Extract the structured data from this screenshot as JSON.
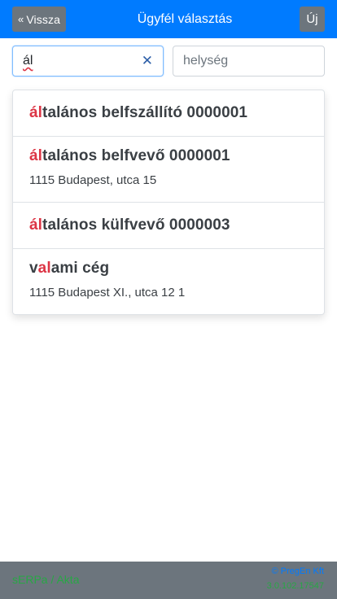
{
  "header": {
    "back_label": "Vissza",
    "back_icon": "«",
    "title": "Ügyfél választás",
    "new_label": "Új"
  },
  "search": {
    "value": "ál",
    "clear_icon": "✕",
    "city_placeholder": "helység"
  },
  "results": [
    {
      "highlight": "ál",
      "rest": "talános belfszállító 0000001",
      "address": ""
    },
    {
      "highlight": "ál",
      "rest": "talános belfvevő 0000001",
      "address": "1115 Budapest, utca 15"
    },
    {
      "highlight": "ál",
      "rest": "talános külfvevő 0000003",
      "address": ""
    },
    {
      "prefix": "v",
      "highlight": "al",
      "rest": "ami cég",
      "address": "1115 Budapest XI., utca 12 1"
    }
  ],
  "footer": {
    "app": "sERPa / Akta",
    "company": "© PregEn Kft",
    "version": "3.0.102.17547"
  },
  "colors": {
    "primary": "#007bff",
    "secondary": "#6c757d",
    "highlight": "#dc3545",
    "success": "#28a745"
  }
}
